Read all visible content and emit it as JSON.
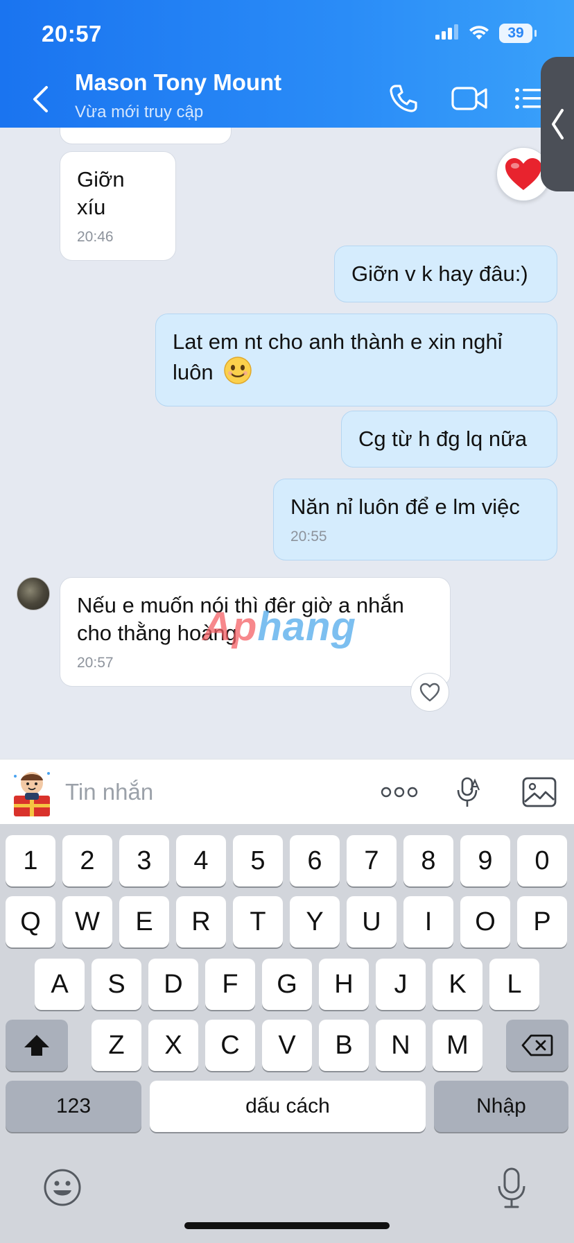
{
  "status_bar": {
    "time": "20:57",
    "battery": "39"
  },
  "header": {
    "contact_name": "Mason Tony Mount",
    "contact_status": "Vừa mới truy cập"
  },
  "messages": [
    {
      "side": "incoming",
      "text": "Giỡn xíu",
      "time": "20:46"
    },
    {
      "side": "outgoing",
      "text": "Giỡn v k hay đâu:)"
    },
    {
      "side": "outgoing",
      "text": "Lat em nt cho anh thành e xin nghỉ luôn"
    },
    {
      "side": "outgoing",
      "text": "Cg từ h đg lq nữa"
    },
    {
      "side": "outgoing",
      "text": "Năn nỉ luôn để e lm việc",
      "time": "20:55"
    },
    {
      "side": "incoming",
      "text": "Nếu e muốn nói thì đêr giờ a nhắn cho thằng hoàng",
      "time": "20:57"
    }
  ],
  "watermark": {
    "part1": "Ap",
    "part2": "hang"
  },
  "input": {
    "placeholder": "Tin nhắn"
  },
  "keyboard": {
    "row_numbers": [
      "1",
      "2",
      "3",
      "4",
      "5",
      "6",
      "7",
      "8",
      "9",
      "0"
    ],
    "row1": [
      "Q",
      "W",
      "E",
      "R",
      "T",
      "Y",
      "U",
      "I",
      "O",
      "P"
    ],
    "row2": [
      "A",
      "S",
      "D",
      "F",
      "G",
      "H",
      "J",
      "K",
      "L"
    ],
    "row3": [
      "Z",
      "X",
      "C",
      "V",
      "B",
      "N",
      "M"
    ],
    "numbers_key": "123",
    "space_key": "dấu cách",
    "return_key": "Nhập"
  }
}
